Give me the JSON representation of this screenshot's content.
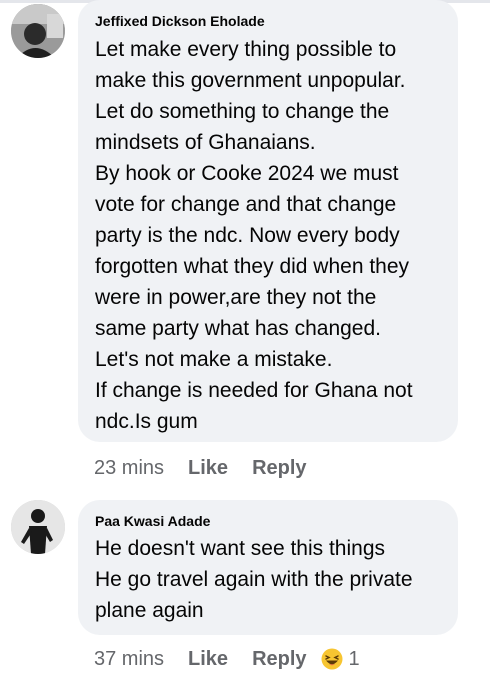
{
  "comments": [
    {
      "author": "Jeffixed Dickson Eholade",
      "lines": [
        "Let make every thing possible to",
        "make this government unpopular.",
        "Let do something to change the",
        "mindsets of Ghanaians.",
        "By hook or Cooke 2024 we must",
        "vote for change and that change",
        "party is the ndc. Now every body",
        "forgotten what they did when they",
        "were in power,are they not the",
        "same party what has changed.",
        "Let's not make a mistake.",
        "If change is needed for Ghana not",
        "ndc.Is gum"
      ],
      "time": "23 mins",
      "like_label": "Like",
      "reply_label": "Reply"
    },
    {
      "author": "Paa Kwasi Adade",
      "lines": [
        "He doesn't want see this things",
        "He go travel again with the private",
        "plane again"
      ],
      "time": "37 mins",
      "like_label": "Like",
      "reply_label": "Reply",
      "reaction_icon": "haha-emoji",
      "reaction_count": "1"
    }
  ]
}
